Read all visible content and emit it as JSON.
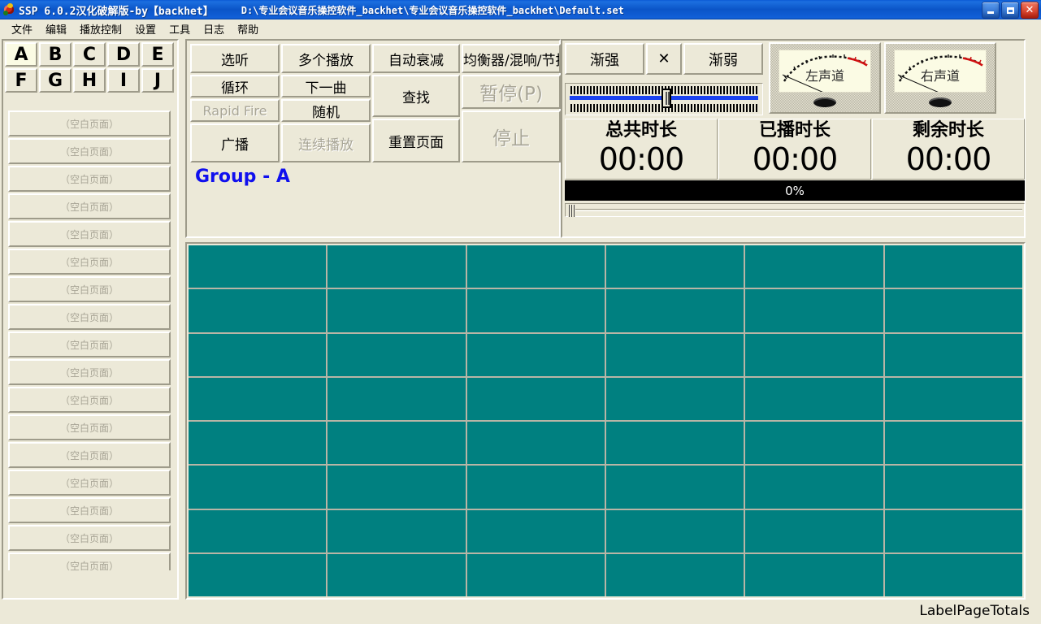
{
  "window": {
    "title": "SSP  6.0.2汉化破解版-by【backhet】",
    "file_path": "D:\\专业会议音乐操控软件_backhet\\专业会议音乐操控软件_backhet\\Default.set",
    "icon": "app-icon",
    "controls": {
      "minimize": "minimize-icon",
      "maximize": "maximize-icon",
      "close": "✕"
    }
  },
  "menubar": {
    "items": [
      {
        "label": "文件"
      },
      {
        "label": "编辑"
      },
      {
        "label": "播放控制"
      },
      {
        "label": "设置"
      },
      {
        "label": "工具"
      },
      {
        "label": "日志"
      },
      {
        "label": "帮助"
      }
    ]
  },
  "sidebar": {
    "group_buttons": [
      {
        "label": "A",
        "active": true
      },
      {
        "label": "B",
        "active": false
      },
      {
        "label": "C",
        "active": false
      },
      {
        "label": "D",
        "active": false
      },
      {
        "label": "E",
        "active": false
      },
      {
        "label": "F",
        "active": false
      },
      {
        "label": "G",
        "active": false
      },
      {
        "label": "H",
        "active": false
      },
      {
        "label": "I",
        "active": false
      },
      {
        "label": "J",
        "active": false
      }
    ],
    "pages": [
      {
        "label": "（空白页面）"
      },
      {
        "label": "（空白页面）"
      },
      {
        "label": "（空白页面）"
      },
      {
        "label": "（空白页面）"
      },
      {
        "label": "（空白页面）"
      },
      {
        "label": "（空白页面）"
      },
      {
        "label": "（空白页面）"
      },
      {
        "label": "（空白页面）"
      },
      {
        "label": "（空白页面）"
      },
      {
        "label": "（空白页面）"
      },
      {
        "label": "（空白页面）"
      },
      {
        "label": "（空白页面）"
      },
      {
        "label": "（空白页面）"
      },
      {
        "label": "（空白页面）"
      },
      {
        "label": "（空白页面）"
      },
      {
        "label": "（空白页面）"
      },
      {
        "label": "（空白页面）"
      }
    ]
  },
  "controls": {
    "listen": "选听",
    "multi_play": "多个播放",
    "auto_fade": "自动衰减",
    "equalizer": "均衡器/混响/节拍",
    "loop": "循环",
    "next_track": "下一曲",
    "find": "查找",
    "pause": "暂停(P)",
    "rapid_fire": "Rapid Fire",
    "random": "随机",
    "broadcast": "广播",
    "continuous_play": "连续播放",
    "reset_page": "重置页面",
    "stop": "停止",
    "group_label": "Group - A"
  },
  "transport": {
    "fade_in": "渐强",
    "fade_stop": "✕",
    "fade_out": "渐弱"
  },
  "meters": {
    "left_channel": "左声道",
    "right_channel": "右声道"
  },
  "times": [
    {
      "label": "总共时长",
      "value": "00:00"
    },
    {
      "label": "已播时长",
      "value": "00:00"
    },
    {
      "label": "剩余时长",
      "value": "00:00"
    }
  ],
  "progress": {
    "percent_label": "0%",
    "percent": 0
  },
  "grid": {
    "columns": 6,
    "rows": 8,
    "cells": [
      "",
      "",
      "",
      "",
      "",
      "",
      "",
      "",
      "",
      "",
      "",
      "",
      "",
      "",
      "",
      "",
      "",
      "",
      "",
      "",
      "",
      "",
      "",
      "",
      "",
      "",
      "",
      "",
      "",
      "",
      "",
      "",
      "",
      "",
      "",
      "",
      "",
      "",
      "",
      "",
      "",
      "",
      "",
      "",
      "",
      "",
      "",
      ""
    ]
  },
  "status": {
    "label": "LabelPageTotals"
  },
  "colors": {
    "titlebar": "#0b55c8",
    "face": "#ece9d8",
    "cell": "#008080",
    "group_label": "#1010ee",
    "progress_bg": "#000000",
    "slider": "#1a42f0"
  }
}
